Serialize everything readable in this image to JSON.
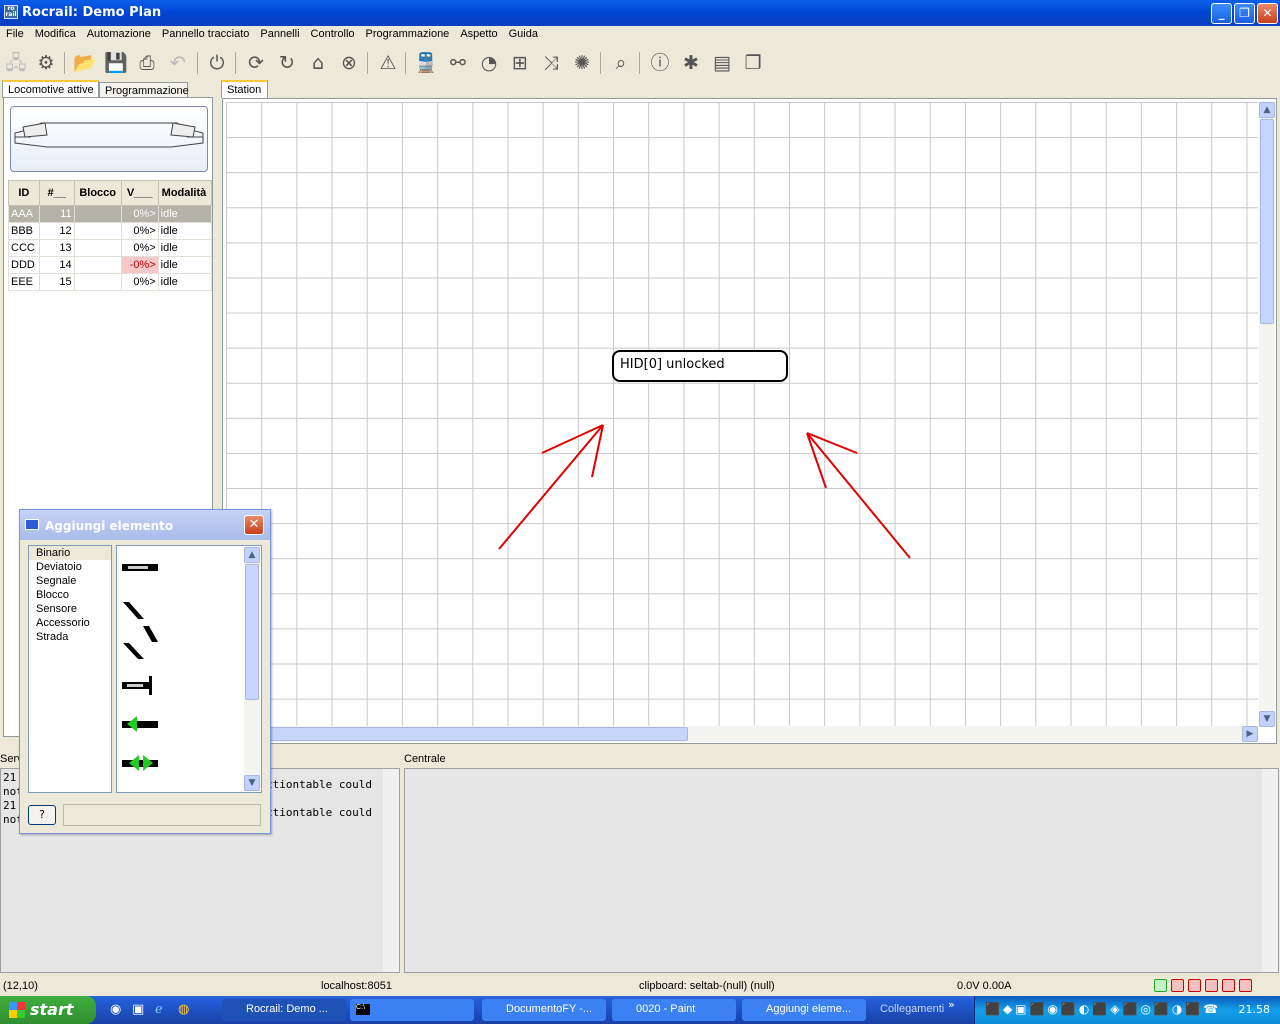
{
  "window": {
    "title": "Rocrail: Demo Plan",
    "min": "_",
    "max": "❐",
    "close": "✕"
  },
  "menu": [
    "File",
    "Modifica",
    "Automazione",
    "Pannello tracciato",
    "Pannelli",
    "Controllo",
    "Programmazione",
    "Aspetto",
    "Guida"
  ],
  "toolbar_icons": [
    "network-icon",
    "settings-icon",
    "open-icon",
    "save-icon",
    "print-icon",
    "undo-icon",
    "power-icon",
    "sync-icon",
    "refresh-icon",
    "home-icon",
    "stop-icon",
    "warning-icon",
    "locomotive-icon",
    "switch-icon",
    "speedometer-icon",
    "grid-icon",
    "shuffle-icon",
    "light-icon",
    "search-icon",
    "info-icon",
    "debug-icon",
    "document-icon",
    "copy-icon"
  ],
  "left_tabs": {
    "active": "Locomotive attive",
    "other": "Programmazione"
  },
  "loco_table": {
    "headers": [
      "ID",
      "#__",
      "Blocco",
      "V___",
      "Modalità"
    ],
    "rows": [
      {
        "id": "AAA",
        "num": "11",
        "block": "",
        "speed": "0%>",
        "mode": "idle"
      },
      {
        "id": "BBB",
        "num": "12",
        "block": "",
        "speed": "0%>",
        "mode": "idle"
      },
      {
        "id": "CCC",
        "num": "13",
        "block": "",
        "speed": "0%>",
        "mode": "idle"
      },
      {
        "id": "DDD",
        "num": "14",
        "block": "",
        "speed": "-0%>",
        "mode": "idle"
      },
      {
        "id": "EEE",
        "num": "15",
        "block": "",
        "speed": "0%>",
        "mode": "idle"
      }
    ]
  },
  "station": {
    "tab": "Station",
    "message": "HID[0] unlocked",
    "arrow_color": "#e00000"
  },
  "server_label": "Serv",
  "central_label": "Centrale",
  "server_log": [
    "21",
    "not",
    "21",
    "not"
  ],
  "server_log_right": [
    "ctiontable could",
    "ctiontable could"
  ],
  "status": {
    "coords": "(12,10)",
    "host": "localhost:8051",
    "clipboard": "clipboard: seltab-(null) (null)",
    "power": "0.0V 0.00A"
  },
  "dialog": {
    "title": "Aggiungi elemento",
    "items": [
      "Binario",
      "Deviatoio",
      "Segnale",
      "Blocco",
      "Sensore",
      "Accessorio",
      "Strada"
    ],
    "help_label": "?"
  },
  "taskbar": {
    "start": "start",
    "tasks": [
      "Rocrail: Demo ...",
      "",
      "DocumentoFY -...",
      "0020 - Paint",
      "Aggiungi eleme...",
      "Collegamenti"
    ],
    "clock": "21.58"
  }
}
